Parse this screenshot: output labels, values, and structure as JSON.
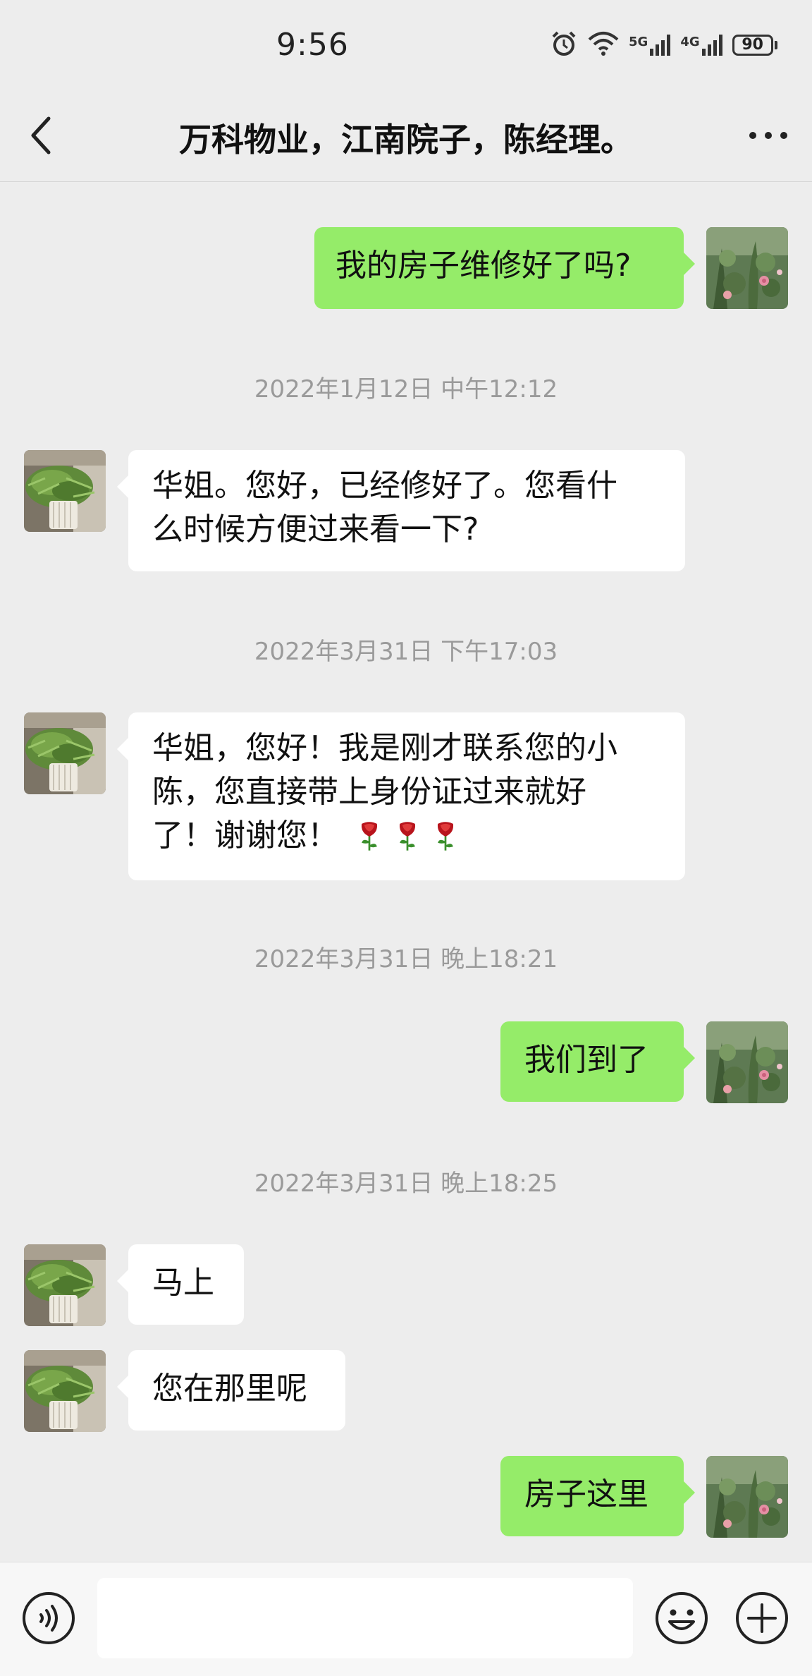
{
  "status_bar": {
    "time": "9:56",
    "net1": "5G",
    "net2": "4G",
    "battery": "90"
  },
  "header": {
    "title": "万科物业，江南院子，陈经理。"
  },
  "messages": {
    "m1": "我的房子维修好了吗?",
    "t1": "2022年1月12日 中午12:12",
    "m2_l1": "华姐。您好，已经修好了。您看什",
    "m2_l2": "么时候方便过来看一下?",
    "t2": "2022年3月31日 下午17:03",
    "m3_l1": "华姐，您好！我是刚才联系您的小",
    "m3_l2": "陈，您直接带上身份证过来就好",
    "m3_l3": "了！谢谢您！",
    "t3": "2022年3月31日 晚上18:21",
    "m4": "我们到了",
    "t4": "2022年3月31日 晚上18:25",
    "m5": "马上",
    "m6": "您在那里呢",
    "m7": "房子这里"
  },
  "icons": {
    "back": "chevron-left-icon",
    "more": "more-icon",
    "voice": "voice-icon",
    "emoji": "emoji-icon",
    "plus": "plus-icon",
    "rose": "rose-icon"
  },
  "colors": {
    "my_bubble": "#95ec69",
    "their_bubble": "#ffffff",
    "background": "#ededed"
  }
}
